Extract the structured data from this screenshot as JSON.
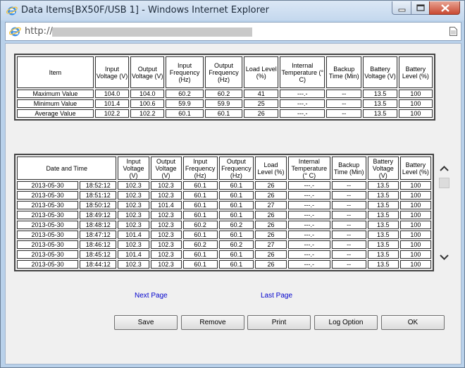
{
  "window": {
    "title": "Data Items[BX50F/USB 1] - Windows Internet Explorer"
  },
  "address": {
    "text": "http://"
  },
  "summary": {
    "headers": [
      "Item",
      "Input Voltage (V)",
      "Output Voltage (V)",
      "Input Frequency (Hz)",
      "Output Frequency (Hz)",
      "Load Level (%)",
      "Internal Temperature (° C)",
      "Backup Time (Min)",
      "Battery Voltage (V)",
      "Battery Level (%)"
    ],
    "rows": [
      [
        "Maximum Value",
        "104.0",
        "104.0",
        "60.2",
        "60.2",
        "41",
        "---.-",
        "--",
        "13.5",
        "100"
      ],
      [
        "Minimum Value",
        "101.4",
        "100.6",
        "59.9",
        "59.9",
        "25",
        "---.-",
        "--",
        "13.5",
        "100"
      ],
      [
        "Average Value",
        "102.2",
        "102.2",
        "60.1",
        "60.1",
        "26",
        "---.-",
        "--",
        "13.5",
        "100"
      ]
    ]
  },
  "log": {
    "headers": [
      "Date and Time",
      "Input Voltage (V)",
      "Output Voltage (V)",
      "Input Frequency (Hz)",
      "Output Frequency (Hz)",
      "Load Level (%)",
      "Internal Temperature (° C)",
      "Backup Time (Min)",
      "Battery Voltage (V)",
      "Battery Level (%)"
    ],
    "rows": [
      [
        "2013-05-30",
        "18:52:12",
        "102.3",
        "102.3",
        "60.1",
        "60.1",
        "26",
        "---.-",
        "--",
        "13.5",
        "100"
      ],
      [
        "2013-05-30",
        "18:51:12",
        "102.3",
        "102.3",
        "60.1",
        "60.1",
        "26",
        "---.-",
        "--",
        "13.5",
        "100"
      ],
      [
        "2013-05-30",
        "18:50:12",
        "102.3",
        "101.4",
        "60.1",
        "60.1",
        "27",
        "---.-",
        "--",
        "13.5",
        "100"
      ],
      [
        "2013-05-30",
        "18:49:12",
        "102.3",
        "102.3",
        "60.1",
        "60.1",
        "26",
        "---.-",
        "--",
        "13.5",
        "100"
      ],
      [
        "2013-05-30",
        "18:48:12",
        "102.3",
        "102.3",
        "60.2",
        "60.2",
        "26",
        "---.-",
        "--",
        "13.5",
        "100"
      ],
      [
        "2013-05-30",
        "18:47:12",
        "101.4",
        "102.3",
        "60.1",
        "60.1",
        "26",
        "---.-",
        "--",
        "13.5",
        "100"
      ],
      [
        "2013-05-30",
        "18:46:12",
        "102.3",
        "102.3",
        "60.2",
        "60.2",
        "27",
        "---.-",
        "--",
        "13.5",
        "100"
      ],
      [
        "2013-05-30",
        "18:45:12",
        "101.4",
        "102.3",
        "60.1",
        "60.1",
        "26",
        "---.-",
        "--",
        "13.5",
        "100"
      ],
      [
        "2013-05-30",
        "18:44:12",
        "102.3",
        "102.3",
        "60.1",
        "60.1",
        "26",
        "---.-",
        "--",
        "13.5",
        "100"
      ]
    ]
  },
  "links": {
    "next_page": "Next Page",
    "last_page": "Last Page"
  },
  "buttons": {
    "save": "Save",
    "remove": "Remove",
    "print": "Print",
    "log_option": "Log Option",
    "ok": "OK"
  }
}
